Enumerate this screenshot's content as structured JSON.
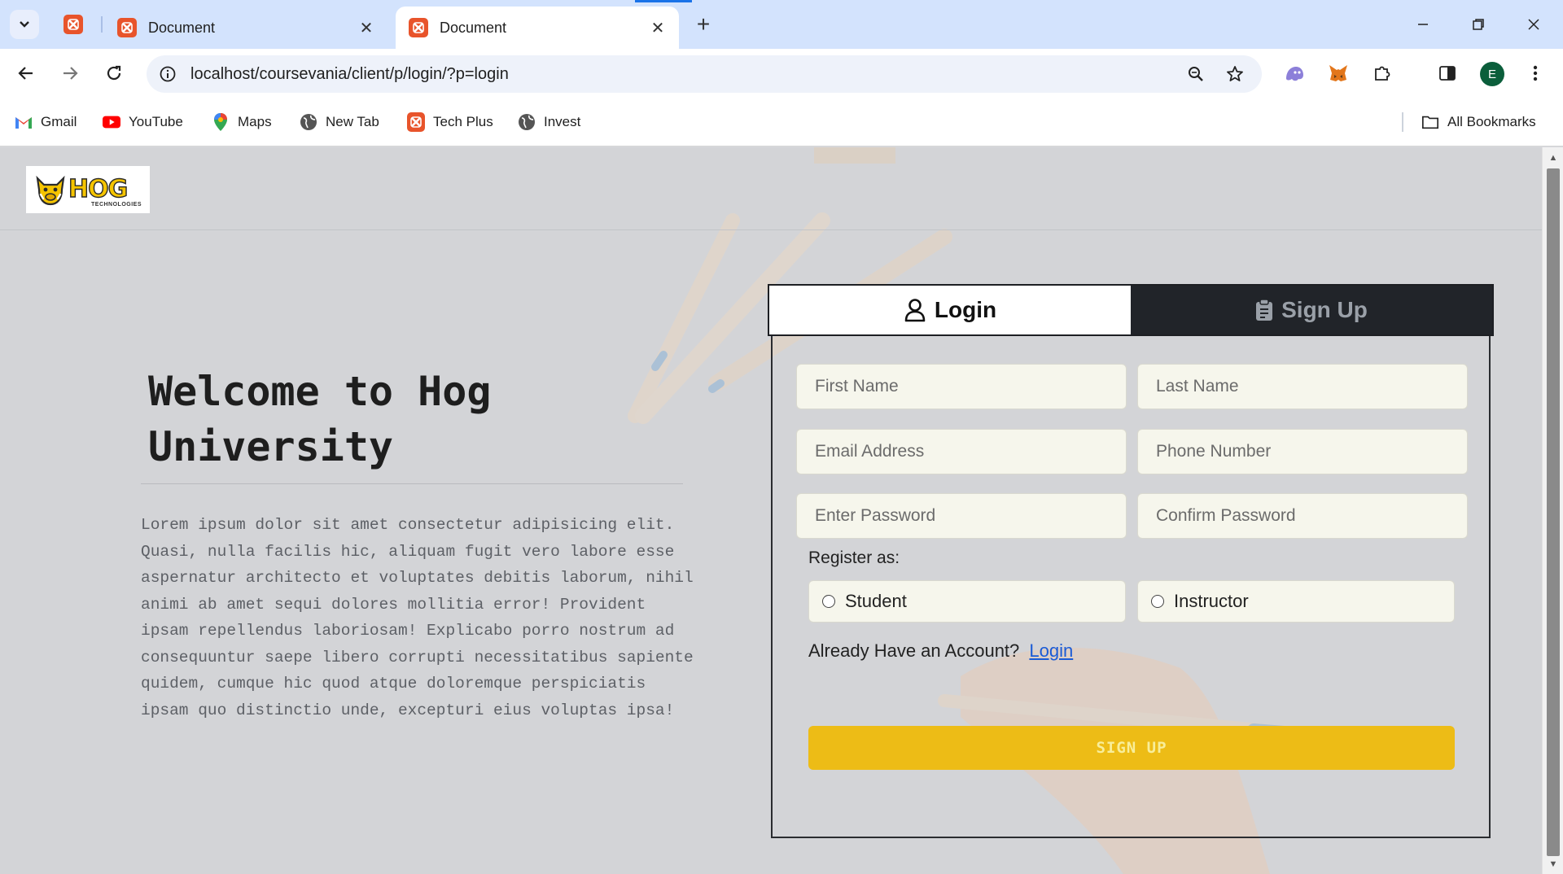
{
  "browser": {
    "tabs": [
      {
        "title": "Document",
        "active": false
      },
      {
        "title": "Document",
        "active": true
      }
    ],
    "url": "localhost/coursevania/client/p/login/?p=login",
    "avatar_letter": "E",
    "bookmarks": [
      {
        "label": "Gmail",
        "icon": "gmail-icon"
      },
      {
        "label": "YouTube",
        "icon": "youtube-icon"
      },
      {
        "label": "Maps",
        "icon": "maps-icon"
      },
      {
        "label": "New Tab",
        "icon": "globe-icon"
      },
      {
        "label": "Tech Plus",
        "icon": "xampp-icon"
      },
      {
        "label": "Invest",
        "icon": "globe-icon"
      }
    ],
    "all_bookmarks": "All Bookmarks"
  },
  "site": {
    "logo_text": "HOG",
    "logo_subtext": "TECHNOLOGIES",
    "welcome_title": "Welcome to Hog University",
    "intro_text": "Lorem ipsum dolor sit amet consectetur adipisicing elit. Quasi, nulla facilis hic, aliquam fugit vero labore esse aspernatur architecto et voluptates debitis laborum, nihil animi ab amet sequi dolores mollitia error! Provident ipsam repellendus laboriosam! Explicabo porro nostrum ad consequuntur saepe libero corrupti necessitatibus sapiente quidem, cumque hic quod atque doloremque perspiciatis ipsam quo distinctio unde, excepturi eius voluptas ipsa!"
  },
  "form": {
    "tab_login": "Login",
    "tab_signup": "Sign Up",
    "active_tab": "login",
    "fields": {
      "first_name": "First Name",
      "last_name": "Last Name",
      "email": "Email Address",
      "phone": "Phone Number",
      "password": "Enter Password",
      "confirm_password": "Confirm Password"
    },
    "register_label": "Register as:",
    "roles": [
      "Student",
      "Instructor"
    ],
    "account_prompt": "Already Have an Account?",
    "login_link": "Login",
    "submit_label": "SIGN UP"
  },
  "colors": {
    "accent_button": "#edbc16",
    "dark_tab": "#212429",
    "field_bg": "#f6f6ec"
  }
}
